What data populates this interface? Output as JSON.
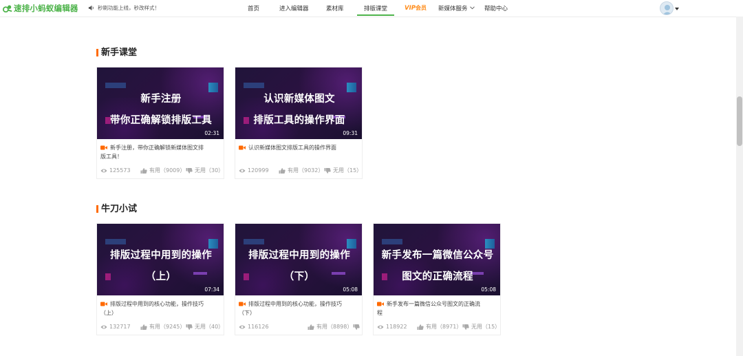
{
  "header": {
    "logo_text": "速排小蚂蚁编辑器",
    "notice": "秒刷功能上线，秒改样式！",
    "nav": [
      {
        "label": "首页"
      },
      {
        "label": "进入编辑器"
      },
      {
        "label": "素材库"
      },
      {
        "label": "排版课堂"
      },
      {
        "label": "VIP",
        "label_cn": "会员"
      },
      {
        "label": "新媒体服务"
      },
      {
        "label": "帮助中心"
      }
    ],
    "active_tab": "排版课堂"
  },
  "colors": {
    "brand_green": "#4db34a",
    "accent_orange": "#ff6a00",
    "vip_orange": "#ff8c1a"
  },
  "sections": [
    {
      "title": "新手课堂",
      "cards": [
        {
          "thumb_line1": "新手注册",
          "thumb_line2": "带你正确解锁排版工具",
          "duration": "02:31",
          "title_line1": "新手注册，带你正确解锁新媒体图文排",
          "title_line2": "版工具！",
          "views": "125573",
          "useful": "有用（9009）",
          "useless": "无用（30）"
        },
        {
          "thumb_line1": "认识新媒体图文",
          "thumb_line2": "排版工具的操作界面",
          "duration": "09:31",
          "title_line1": "认识新媒体图文排版工具的操作界面",
          "title_line2": "",
          "views": "120999",
          "useful": "有用（9032）",
          "useless": "无用（15）"
        }
      ]
    },
    {
      "title": "牛刀小试",
      "cards": [
        {
          "thumb_line1": "排版过程中用到的操作",
          "thumb_line2": "（上）",
          "duration": "07:34",
          "title_line1": "排版过程中用到的核心功能，操作技巧",
          "title_line2": "（上）",
          "views": "132717",
          "useful": "有用（9245）",
          "useless": "无用（40）"
        },
        {
          "thumb_line1": "排版过程中用到的操作",
          "thumb_line2": "（下）",
          "duration": "05:08",
          "title_line1": "排版过程中用到的核心功能，操作技巧",
          "title_line2": "（下）",
          "views": "116126",
          "useful": "有用（8898）",
          "useless": ""
        },
        {
          "thumb_line1": "新手发布一篇微信公众号",
          "thumb_line2": "图文的正确流程",
          "duration": "05:08",
          "title_line1": "新手发布一篇微信公众号图文的正确流",
          "title_line2": "程",
          "views": "118922",
          "useful": "有用（8971）",
          "useless": "无用（15）"
        }
      ]
    }
  ],
  "icons": [
    "logo-icon",
    "speaker-icon",
    "chevron-down-icon",
    "avatar-icon",
    "video-camera-icon",
    "eye-icon",
    "thumbs-up-icon",
    "thumbs-down-icon"
  ]
}
